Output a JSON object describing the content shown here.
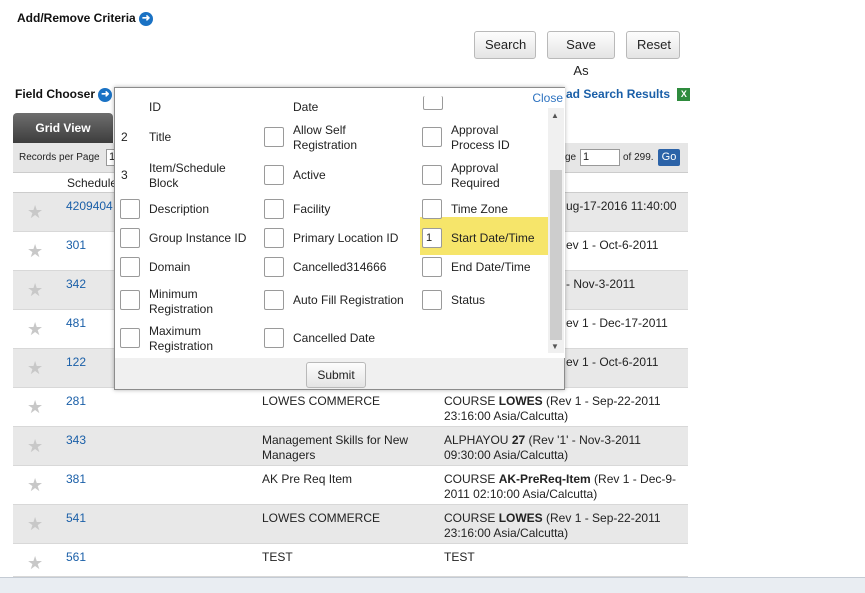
{
  "header": {
    "add_remove_label": "Add/Remove Criteria",
    "field_chooser_label": "Field Chooser",
    "download_label": "ad Search Results"
  },
  "buttons": {
    "search": "Search",
    "save_as": "Save As",
    "reset": "Reset"
  },
  "grid": {
    "tab_label": "Grid View",
    "records_per_page": "Records per Page",
    "records_value": "1",
    "page_label": "ge",
    "page_value": "1",
    "page_total": "of 299.",
    "go_label": "Go",
    "col_schedule": "Schedule",
    "rows": [
      {
        "id": "4209404",
        "name": "",
        "inst": "ug-17-2016 11:40:00"
      },
      {
        "id": "301",
        "name": "",
        "inst": "ev 1 - Oct-6-2011"
      },
      {
        "id": "342",
        "name": "",
        "inst": "- Nov-3-2011"
      },
      {
        "id": "481",
        "name": "",
        "inst": "ev 1 - Dec-17-2011"
      },
      {
        "id": "122",
        "name": "",
        "inst": "ev 1 - Oct-6-2011"
      },
      {
        "id": "281",
        "name": "LOWES COMMERCE",
        "inst_pre": "COURSE ",
        "inst_bold": "LOWES",
        "inst_post": " (Rev 1 - Sep-22-2011 23:16:00 Asia/Calcutta)"
      },
      {
        "id": "343",
        "name": "Management Skills for New Managers",
        "inst_pre": "ALPHAYOU ",
        "inst_bold": "27",
        "inst_post": " (Rev '1' - Nov-3-2011 09:30:00 Asia/Calcutta)"
      },
      {
        "id": "381",
        "name": "AK Pre Req Item",
        "inst_pre": "COURSE ",
        "inst_bold": "AK-PreReq-Item",
        "inst_post": " (Rev 1 - Dec-9-2011 02:10:00 Asia/Calcutta)"
      },
      {
        "id": "541",
        "name": "LOWES COMMERCE",
        "inst_pre": "COURSE ",
        "inst_bold": "LOWES",
        "inst_post": " (Rev 1 - Sep-22-2011 23:16:00 Asia/Calcutta)"
      },
      {
        "id": "561",
        "name": "TEST",
        "inst": "TEST"
      }
    ]
  },
  "field_chooser": {
    "close_label": "Close",
    "submit_label": "Submit",
    "top_partial": [
      "ID",
      "Date"
    ],
    "col1": [
      {
        "num": "2",
        "label": "Title"
      },
      {
        "num": "3",
        "label": "Item/Schedule Block"
      },
      {
        "label": "Description"
      },
      {
        "label": "Group Instance ID"
      },
      {
        "label": "Domain"
      },
      {
        "label": "Minimum Registration"
      },
      {
        "label": "Maximum Registration"
      }
    ],
    "col2": [
      "Allow Self Registration",
      "Active",
      "Facility",
      "Primary Location ID",
      "Cancelled314666",
      "Auto Fill Registration",
      "Cancelled Date"
    ],
    "col3": [
      "Approval Process ID",
      "Approval Required",
      "Time Zone",
      "Start Date/Time",
      "End Date/Time",
      "Status"
    ],
    "start_order_value": "1",
    "highlight_color": "#f6e56a"
  }
}
